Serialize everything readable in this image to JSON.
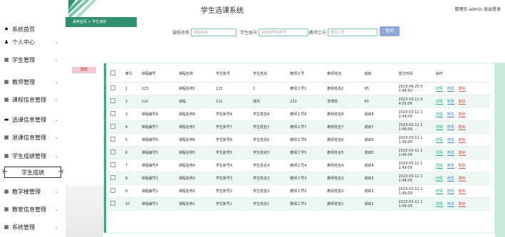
{
  "header": {
    "title": "学生选课系统",
    "user_text": "管理员 admin  退出登录"
  },
  "breadcrumb": "系统首页 > 学生成绩",
  "sidebar": {
    "items": [
      {
        "icon": "home-icon",
        "glyph": "♠",
        "label": "系统首页",
        "chevron": ""
      },
      {
        "icon": "user-icon",
        "glyph": "♟",
        "label": "个人中心",
        "chevron": "⌄"
      },
      {
        "icon": "grid-icon",
        "glyph": "▦",
        "label": "学生管理",
        "chevron": "⌄"
      },
      {
        "icon": "grid-icon",
        "glyph": "▦",
        "label": "教师管理",
        "chevron": "⌄"
      },
      {
        "icon": "grid-icon",
        "glyph": "▦",
        "label": "课程信息管理",
        "chevron": "⌄"
      },
      {
        "icon": "grid-icon",
        "glyph": "▬",
        "label": "选课信息管理",
        "chevron": "⌄"
      },
      {
        "icon": "grid-icon",
        "glyph": "▦",
        "label": "退课信息管理",
        "chevron": "⌄"
      },
      {
        "icon": "grid-icon",
        "glyph": "▦",
        "label": "学生成绩管理",
        "chevron": "⌄"
      },
      {
        "icon": "grid-icon",
        "glyph": "▦",
        "label": "教学楼管理",
        "chevron": "⌄"
      },
      {
        "icon": "grid-icon",
        "glyph": "▦",
        "label": "教室信息管理",
        "chevron": "⌄"
      },
      {
        "icon": "grid-icon",
        "glyph": "▦",
        "label": "系统管理",
        "chevron": "⌄"
      }
    ],
    "active_sub": "学生成绩"
  },
  "search": {
    "course_label": "课程名称",
    "course_placeholder": "课程名称",
    "student_label": "学生账号",
    "student_placeholder": "请选择学生账号",
    "teacher_label": "教师工号",
    "teacher_placeholder": "教师工号",
    "button": "查询"
  },
  "delete_button": "删除",
  "table": {
    "headers": [
      "",
      "索引",
      "课程编号",
      "课程名称",
      "学生账号",
      "学生姓名",
      "教师工号",
      "教师姓名",
      "成绩",
      "登记时间",
      "操作"
    ],
    "ops": [
      "详情",
      "修改",
      "删除"
    ],
    "rows": [
      [
        "1",
        "123",
        "课程名称1",
        "123",
        "1",
        "教师工号1",
        "教师姓名1",
        "95",
        "2023-06-25 0 7:44:50"
      ],
      [
        "2",
        "222",
        "课程",
        "111",
        "胡月",
        "222",
        "李明凯",
        "85",
        "2023-03-11 0 4:05:06"
      ],
      [
        "3",
        "课程编号8",
        "课程名称8",
        "学生账号8",
        "学生姓名8",
        "教师工号8",
        "教师姓名8",
        "成绩8",
        "2023-03-11 1 1:49:09"
      ],
      [
        "4",
        "课程编号7",
        "课程名称7",
        "学生账号7",
        "学生姓名7",
        "教师工号7",
        "教师姓名7",
        "成绩7",
        "2023-03-11 1 1:49:09"
      ],
      [
        "5",
        "课程编号6",
        "课程名称6",
        "学生账号6",
        "学生姓名6",
        "教师工号6",
        "教师姓名6",
        "成绩6",
        "2023-03-11 1 1:49:09"
      ],
      [
        "6",
        "课程编号5",
        "课程名称5",
        "学生账号5",
        "学生姓名5",
        "教师工号5",
        "教师姓名5",
        "成绩5",
        "2023-03-11 1 1:49:09"
      ],
      [
        "7",
        "课程编号4",
        "课程名称4",
        "学生账号4",
        "学生姓名4",
        "教师工号4",
        "教师姓名4",
        "成绩4",
        "2023-03-11 1 1:49:09"
      ],
      [
        "8",
        "课程编号3",
        "课程名称3",
        "学生账号3",
        "学生姓名3",
        "教师工号3",
        "教师姓名3",
        "成绩3",
        "2023-03-11 1 1:49:09"
      ],
      [
        "9",
        "课程编号2",
        "课程名称2",
        "学生账号2",
        "学生姓名2",
        "教师工号2",
        "教师姓名2",
        "成绩2",
        "2023-03-11 1 1:49:09"
      ],
      [
        "10",
        "课程编号1",
        "课程名称1",
        "学生账号1",
        "学生姓名1",
        "教师工号1",
        "教师姓名1",
        "成绩1",
        "2023-03-11 1 1:49:09"
      ]
    ]
  },
  "colors": {
    "accent": "#2f8f6f",
    "search_button": "#8da8d8",
    "delete": "#f2c9cc"
  }
}
